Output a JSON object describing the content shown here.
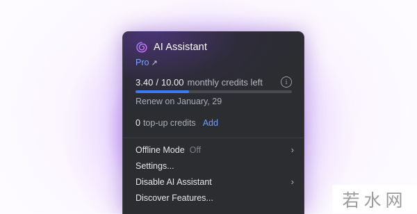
{
  "popup": {
    "title": "AI Assistant",
    "plan": "Pro",
    "plan_link_icon": "external-arrow-icon",
    "credits": {
      "used": "3.40",
      "separator": "/",
      "total": "10.00",
      "label": "monthly credits left",
      "progress_fraction": 0.34,
      "info_icon": "info-icon",
      "renew_text": "Renew on January, 29"
    },
    "topup": {
      "count": "0",
      "label": "top-up credits",
      "add_label": "Add"
    },
    "menu": [
      {
        "label": "Offline Mode",
        "secondary": "Off",
        "has_submenu": true
      },
      {
        "label": "Settings...",
        "secondary": "",
        "has_submenu": false
      },
      {
        "label": "Disable AI Assistant",
        "secondary": "",
        "has_submenu": true
      },
      {
        "label": "Discover Features...",
        "secondary": "",
        "has_submenu": false
      }
    ],
    "colors": {
      "background": "#2b2d30",
      "accent": "#3d7bf5",
      "link": "#7ba4ff"
    }
  },
  "watermark": {
    "text": "若水网"
  }
}
